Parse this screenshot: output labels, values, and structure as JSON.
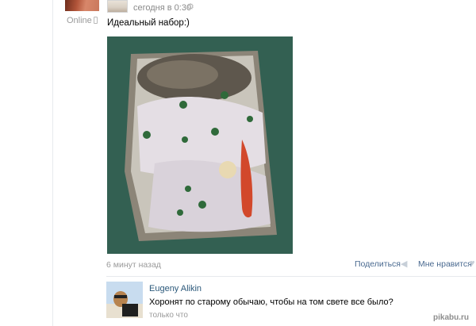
{
  "post": {
    "status": "Online",
    "time": "сегодня в 0:30",
    "text": "Идеальный набор:)",
    "age": "6 минут назад",
    "share_label": "Поделиться",
    "like_label": "Мне нравится"
  },
  "comment": {
    "author": "Eugeny Alikin",
    "text": "Хоронят по старому обычаю, чтобы на том свете все было?",
    "time": "только что"
  },
  "icons": {
    "settings": "gear-icon",
    "share": "megaphone-icon",
    "like": "heart-icon",
    "online": "mobile-phone-icon"
  },
  "colors": {
    "link": "#2b587a",
    "muted": "#9a9a9a",
    "action": "#4a6a90"
  },
  "watermark": "pikabu.ru"
}
